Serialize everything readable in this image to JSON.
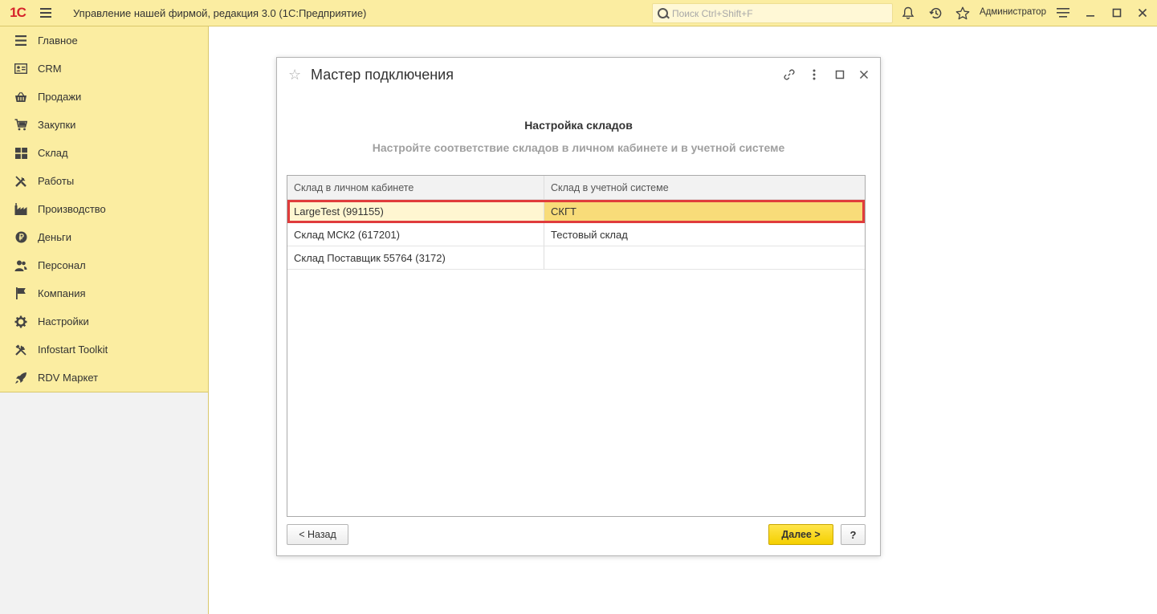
{
  "titlebar": {
    "logo": "1С",
    "app_title": "Управление нашей фирмой, редакция 3.0  (1С:Предприятие)",
    "search_placeholder": "Поиск Ctrl+Shift+F",
    "user": "Администратор"
  },
  "sidebar": {
    "items": [
      {
        "label": "Главное",
        "icon": "menu-lines-icon"
      },
      {
        "label": "CRM",
        "icon": "contact-card-icon"
      },
      {
        "label": "Продажи",
        "icon": "basket-icon"
      },
      {
        "label": "Закупки",
        "icon": "cart-icon"
      },
      {
        "label": "Склад",
        "icon": "warehouse-grid-icon"
      },
      {
        "label": "Работы",
        "icon": "tools-icon"
      },
      {
        "label": "Производство",
        "icon": "factory-icon"
      },
      {
        "label": "Деньги",
        "icon": "ruble-coin-icon"
      },
      {
        "label": "Персонал",
        "icon": "people-icon"
      },
      {
        "label": "Компания",
        "icon": "flag-icon"
      },
      {
        "label": "Настройки",
        "icon": "gear-icon"
      },
      {
        "label": "Infostart Toolkit",
        "icon": "wrench-hammer-icon"
      },
      {
        "label": "RDV Маркет",
        "icon": "rocket-icon"
      }
    ]
  },
  "dialog": {
    "title": "Мастер подключения",
    "heading": "Настройка складов",
    "subheading": "Настройте соответствие складов в личном кабинете и в учетной системе",
    "columns": [
      "Склад в личном кабинете",
      "Склад в учетной системе"
    ],
    "rows": [
      [
        "LargeTest (991155)",
        "СКГТ"
      ],
      [
        "Склад МСК2 (617201)",
        "Тестовый склад"
      ],
      [
        "Склад Поставщик 55764 (3172)",
        ""
      ]
    ],
    "back_label": "< Назад",
    "next_label": "Далее >",
    "help_label": "?"
  },
  "colors": {
    "accent_yellow": "#fbeda1",
    "primary_button": "#f4cf00",
    "highlight_border": "#e03c3c",
    "logo_red": "#d6232b"
  }
}
